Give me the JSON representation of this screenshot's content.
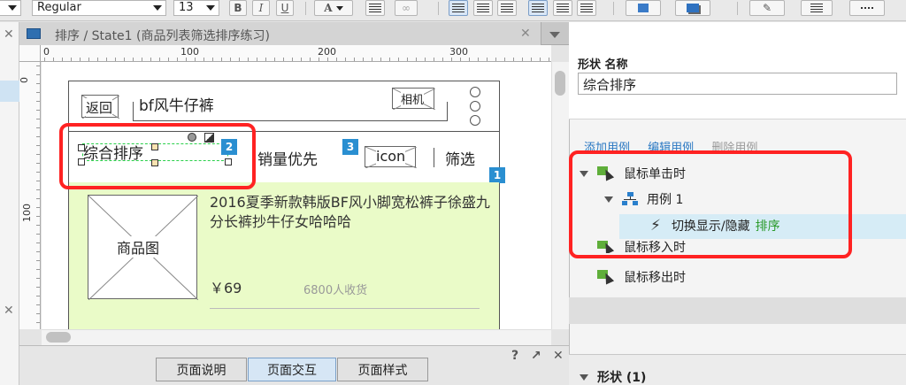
{
  "toolbar": {
    "font_style": "Regular",
    "font_size": "13",
    "bold": "B",
    "italic": "I",
    "underline": "U",
    "font_color": "A"
  },
  "editor": {
    "tab_title": "排序 / State1 (商品列表筛选排序练习)",
    "close_glyph": "✕",
    "ruler_h": [
      "0",
      "100",
      "200",
      "300"
    ],
    "ruler_v": [
      "0",
      "100"
    ]
  },
  "wireframe": {
    "back_label": "返回",
    "title": "bf风牛仔裤",
    "camera_label": "相机",
    "sort_default": "综合排序",
    "sort_sales": "销量优先",
    "icon_label": "icon",
    "filter": "筛选",
    "badge_1": "1",
    "badge_2": "2",
    "badge_3": "3",
    "product_image_label": "商品图",
    "product_title": "2016夏季新款韩版BF风小脚宽松裤子徐盛九分长裤抄牛仔女哈哈哈",
    "price": "￥69",
    "buyers": "6800人收货"
  },
  "bottom_tabs": {
    "notes": "页面说明",
    "interactions": "页面交互",
    "style": "页面样式",
    "help": "?",
    "expand": "↗",
    "close": "✕"
  },
  "right_panel": {
    "shape_name_label": "形状 名称",
    "shape_name_value": "综合排序",
    "add_case": "添加用例",
    "edit_case": "编辑用例",
    "delete_case": "删除用例",
    "events": {
      "on_click": "鼠标单击时",
      "case_1": "用例 1",
      "action": "切换显示/隐藏",
      "action_target": "排序",
      "on_mouse_enter": "鼠标移入时",
      "on_mouse_leave": "鼠标移出时"
    },
    "shape_section": "形状 (1)"
  },
  "colors": {
    "accent_blue": "#2a8fd1",
    "highlight_red": "#ff2222",
    "product_bg": "#eafbc8",
    "event_green": "#5fae3a",
    "target_green": "#2a9a2a"
  }
}
